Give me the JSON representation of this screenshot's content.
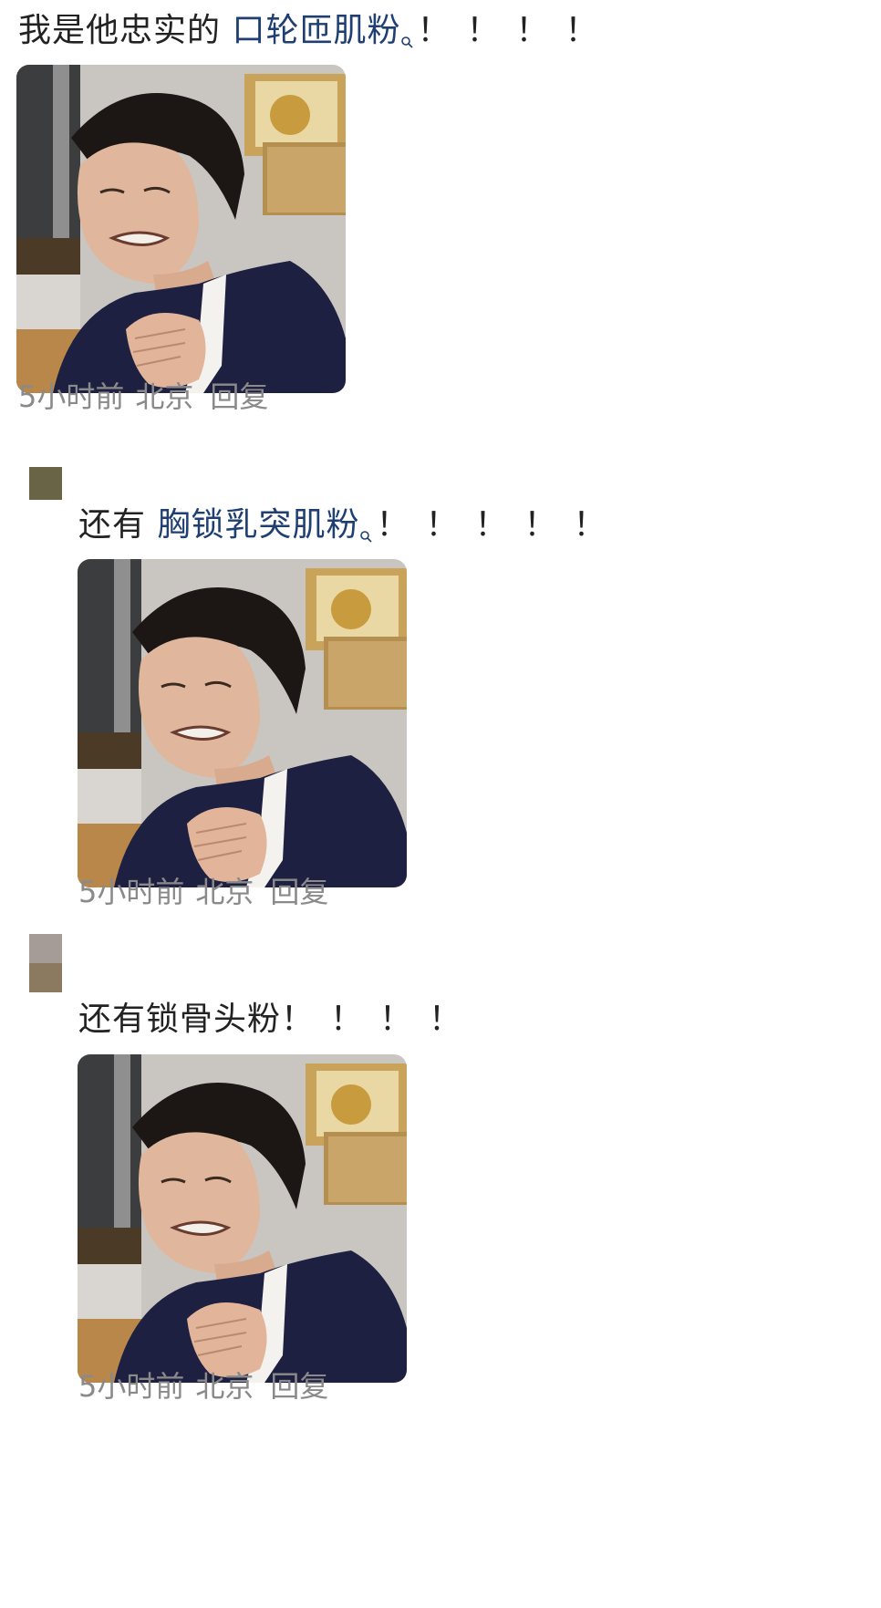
{
  "comments": [
    {
      "text_prefix": "我是他忠实的 ",
      "topic": "口轮匝肌粉",
      "exclaims": "！！！！",
      "time": "5小时前",
      "location": "北京",
      "reply": "回复"
    },
    {
      "text_prefix": "还有 ",
      "topic": "胸锁乳突肌粉",
      "exclaims": "！！！！！",
      "time": "5小时前",
      "location": "北京",
      "reply": "回复"
    },
    {
      "text_prefix": "还有锁骨头粉",
      "topic": "",
      "exclaims": "！！！！",
      "time": "5小时前",
      "location": "北京",
      "reply": "回复"
    }
  ],
  "icons": {
    "topic_search": "search-icon"
  },
  "colors": {
    "topic_link": "#1f3f73",
    "meta_text": "#8a8a8a",
    "avatar_1": "#6a6447",
    "avatar_2_top": "#a59c98",
    "avatar_2_bottom": "#8b7960"
  }
}
